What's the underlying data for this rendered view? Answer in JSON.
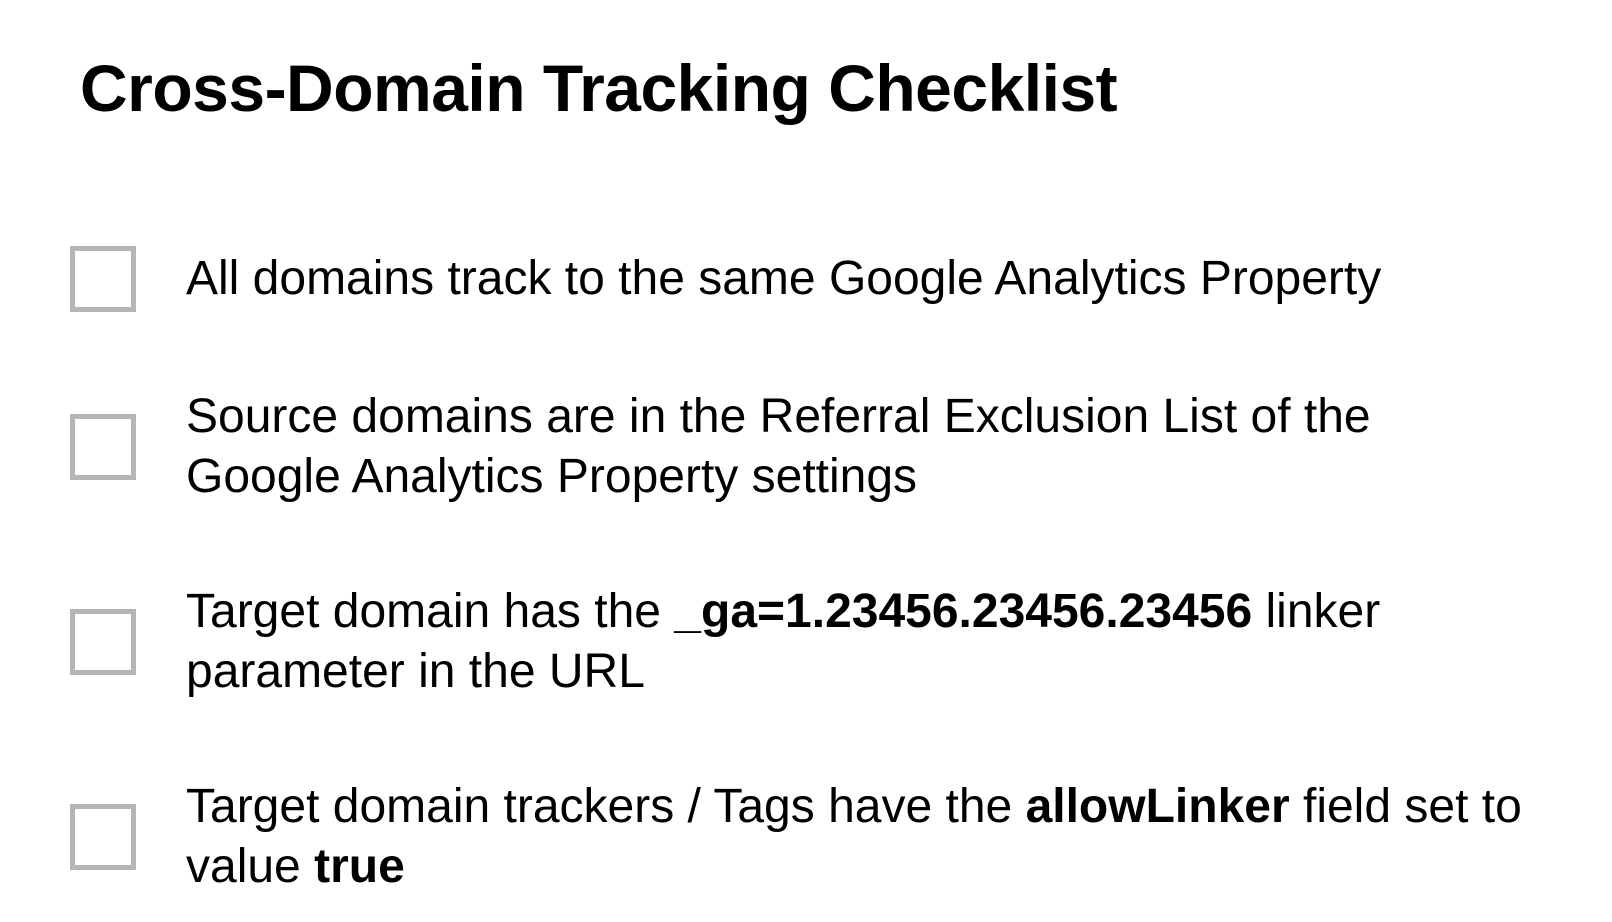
{
  "title": "Cross-Domain Tracking Checklist",
  "items": [
    {
      "pre": "All domains track to the same Google Analytics Property",
      "bold1": "",
      "mid": "",
      "bold2": "",
      "post": ""
    },
    {
      "pre": "Source domains are in the Referral Exclusion List of the Google Analytics Property settings",
      "bold1": "",
      "mid": "",
      "bold2": "",
      "post": ""
    },
    {
      "pre": "Target domain has the ",
      "bold1": "_ga=1.23456.23456.23456",
      "mid": " linker parameter in the URL",
      "bold2": "",
      "post": ""
    },
    {
      "pre": "Target domain trackers / Tags have the ",
      "bold1": "allowLinker",
      "mid": " field set to value ",
      "bold2": "true",
      "post": ""
    }
  ]
}
